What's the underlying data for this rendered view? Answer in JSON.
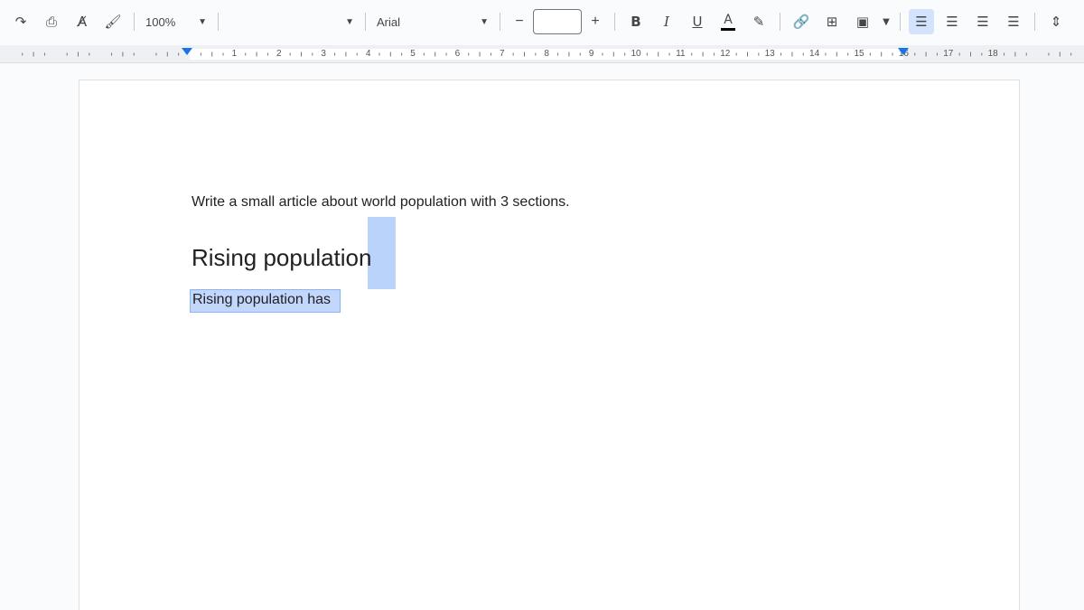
{
  "toolbar": {
    "undo_icon": "redo-icon",
    "zoom": "100%",
    "style": "",
    "font": "Arial",
    "font_size": "",
    "minus": "−",
    "plus": "+",
    "bold": "B",
    "italic": "I",
    "underline": "U",
    "text_color": "A"
  },
  "ruler": {
    "numbers": [
      "1",
      "2",
      "3",
      "4",
      "5",
      "6",
      "7",
      "8",
      "9",
      "10",
      "11",
      "12",
      "13",
      "14",
      "15",
      "16",
      "17",
      "18"
    ]
  },
  "document": {
    "prompt": "Write a small article about world population with 3 sections.",
    "heading": "Rising population",
    "body": "Rising population has"
  },
  "colors": {
    "accent": "#1a73e8",
    "selection": "#c2d7fb",
    "active_button": "#d3e3fd"
  }
}
